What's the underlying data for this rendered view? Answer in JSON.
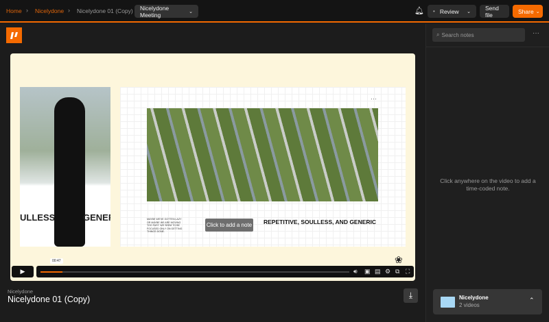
{
  "breadcrumb": {
    "home": "Home",
    "project": "Nicelydone",
    "file": "Nicelydone 01 (Copy)"
  },
  "version_select": "Nicelydone Meeting",
  "header": {
    "status": "Review",
    "send_file": "Send file",
    "share": "Share"
  },
  "notes": {
    "search_placeholder": "Search notes",
    "empty_hint": "Click anywhere on the video to add a time-coded note."
  },
  "video": {
    "left_caption_1": "ULLESS",
    "left_caption_2": "GENER",
    "slide_body": "MAYBE WE'VE GOTTEN LAZY OR MAYBE WE ARE MOVING TOO FAST. WE SEEM TO BE FOCUSED ONLY ON GETTING THINGS DONE.",
    "slide_heading": "REPETITIVE, SOULLESS, AND GENERIC",
    "add_note": "Click to add a note",
    "timestamp": "00:47",
    "progress_fraction": 0.07,
    "buffered_fraction": 0.07
  },
  "file": {
    "project": "Nicelydone",
    "title": "Nicelydone 01 (Copy)"
  },
  "folder": {
    "name": "Nicelydone",
    "count": "2 videos"
  },
  "colors": {
    "accent": "#f56a00"
  }
}
